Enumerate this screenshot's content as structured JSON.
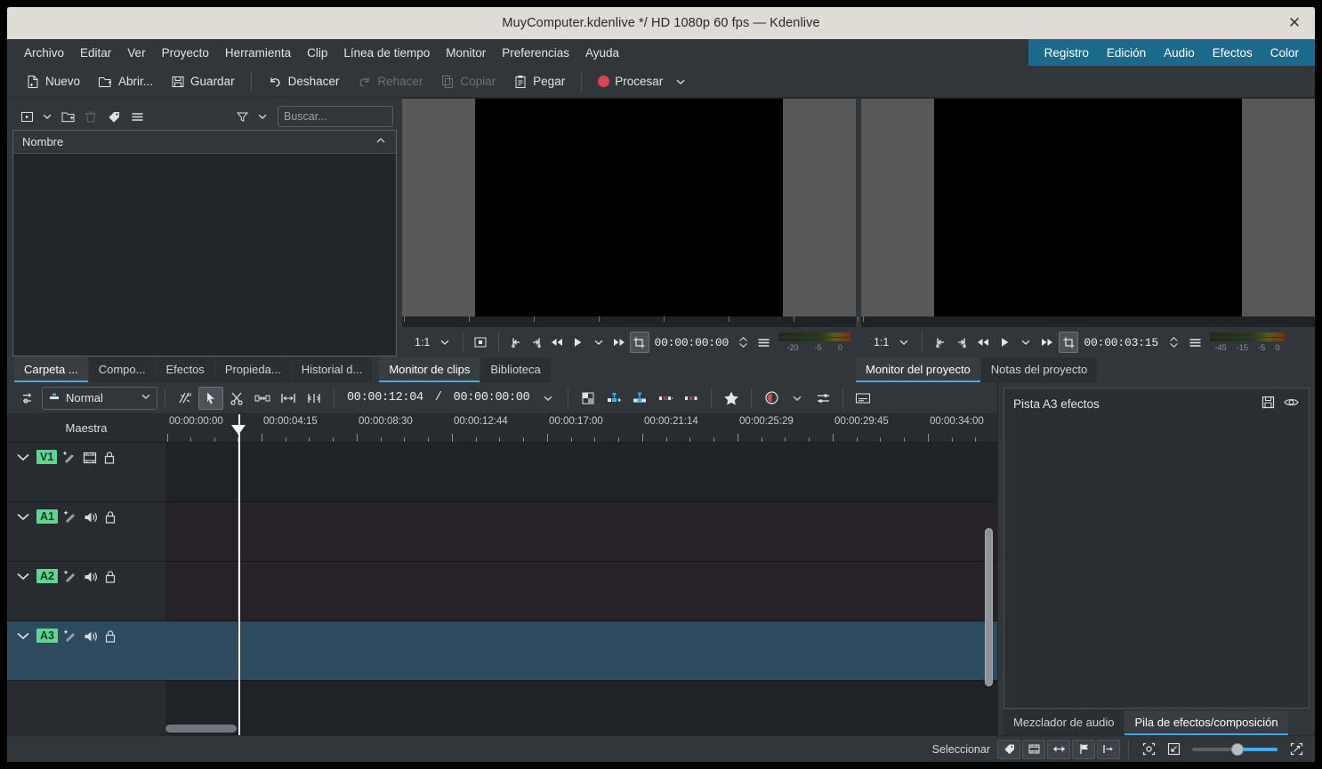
{
  "window": {
    "title": "MuyComputer.kdenlive */ HD 1080p 60 fps — Kdenlive",
    "close_label": "✕"
  },
  "menubar": {
    "items": [
      {
        "label": "Archivo"
      },
      {
        "label": "Editar"
      },
      {
        "label": "Ver"
      },
      {
        "label": "Proyecto"
      },
      {
        "label": "Herramienta"
      },
      {
        "label": "Clip"
      },
      {
        "label": "Línea de tiempo"
      },
      {
        "label": "Monitor"
      },
      {
        "label": "Preferencias"
      },
      {
        "label": "Ayuda"
      }
    ],
    "layouts": [
      {
        "label": "Registro"
      },
      {
        "label": "Edición"
      },
      {
        "label": "Audio"
      },
      {
        "label": "Efectos"
      },
      {
        "label": "Color"
      }
    ],
    "layout_bg": "#1b6a8c"
  },
  "toolbar": {
    "new_label": "Nuevo",
    "open_label": "Abrir...",
    "save_label": "Guardar",
    "undo_label": "Deshacer",
    "redo_label": "Rehacer",
    "copy_label": "Copiar",
    "paste_label": "Pegar",
    "render_label": "Procesar",
    "render_color": "#da4453"
  },
  "bin": {
    "search_placeholder": "Buscar...",
    "column_name": "Nombre",
    "rows": []
  },
  "clip_monitor": {
    "zoom": "1:1",
    "timecode": "00:00:00:00",
    "meter_labels": [
      "-20",
      "-5",
      "0"
    ]
  },
  "project_monitor": {
    "zoom": "1:1",
    "timecode": "00:00:03:15",
    "meter_labels": [
      "-45",
      "-15",
      "-5",
      "0"
    ]
  },
  "left_tabs": [
    {
      "label": "Carpeta ...",
      "active": true
    },
    {
      "label": "Compo...",
      "active": false
    },
    {
      "label": "Efectos",
      "active": false
    },
    {
      "label": "Propieda...",
      "active": false
    },
    {
      "label": "Historial d...",
      "active": false
    },
    {
      "label": "Monitor de clips",
      "active": true
    },
    {
      "label": "Biblioteca",
      "active": false
    }
  ],
  "right_tabs": [
    {
      "label": "Monitor del proyecto",
      "active": true
    },
    {
      "label": "Notas del proyecto",
      "active": false
    }
  ],
  "timeline_toolbar": {
    "edit_mode": "Normal",
    "position_timecode": "00:00:12:04",
    "duration_timecode": "00:00:00:00",
    "separator": "/"
  },
  "timeline": {
    "master_label": "Maestra",
    "ruler_labels": [
      "00:00:00:00",
      "00:00:04:15",
      "00:00:08:30",
      "00:00:12:44",
      "00:00:17:00",
      "00:00:21:14",
      "00:00:25:29",
      "00:00:29:45",
      "00:00:34:00"
    ],
    "tracks": [
      {
        "name": "V1",
        "kind": "video",
        "selected": false
      },
      {
        "name": "A1",
        "kind": "audio",
        "selected": false
      },
      {
        "name": "A2",
        "kind": "audio",
        "selected": false
      },
      {
        "name": "A3",
        "kind": "audio",
        "selected": true
      }
    ],
    "track_badge_color": "#61d490",
    "selection_color": "#2e4a5e"
  },
  "effects_panel": {
    "title": "Pista A3 efectos",
    "tabs": [
      {
        "label": "Mezclador de audio",
        "active": false
      },
      {
        "label": "Pila de efectos/composición",
        "active": true
      }
    ]
  },
  "statusbar": {
    "select_label": "Seleccionar",
    "zoom_value": "46"
  },
  "accent": "#3daee9"
}
